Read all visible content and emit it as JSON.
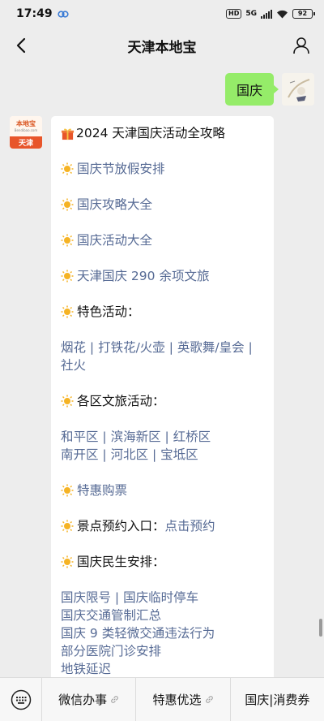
{
  "status_bar": {
    "time": "17:49",
    "hd_badge": "HD",
    "net_badge": "5G",
    "battery": "92"
  },
  "header": {
    "title": "天津本地宝"
  },
  "chat": {
    "sent_message": "国庆",
    "bot_avatar": {
      "logo_text": "本地宝",
      "sub_text": "Bendibao.com",
      "city": "天津"
    },
    "reply": {
      "title": "2024 天津国庆活动全攻略",
      "items": [
        "国庆节放假安排",
        "国庆攻略大全",
        "国庆活动大全",
        "天津国庆 290 余项文旅"
      ],
      "features_heading": "特色活动：",
      "features_line1": "烟花 | 打铁花/火壶 | 英歌舞/皇会 |",
      "features_line2": "社火",
      "district_heading": "各区文旅活动：",
      "district_line1": "和平区 | 滨海新区 | 红桥区",
      "district_line2": "南开区 | 河北区 | 宝坻区",
      "discount": "特惠购票",
      "booking_label": "景点预约入口：",
      "booking_link": "点击预约",
      "livelihood_heading": "国庆民生安排：",
      "livelihood_lines": [
        "国庆限号 | 国庆临时停车",
        "国庆交通管制汇总",
        "国庆 9 类轻微交通违法行为",
        "部分医院门诊安排",
        "地铁延迟"
      ]
    }
  },
  "bottom_menu": {
    "item1": "微信办事",
    "item2": "特惠优选",
    "item3": "国庆|消费券"
  },
  "colors": {
    "link": "#576b95",
    "sent_bubble": "#95ec69",
    "background": "#ededed"
  }
}
